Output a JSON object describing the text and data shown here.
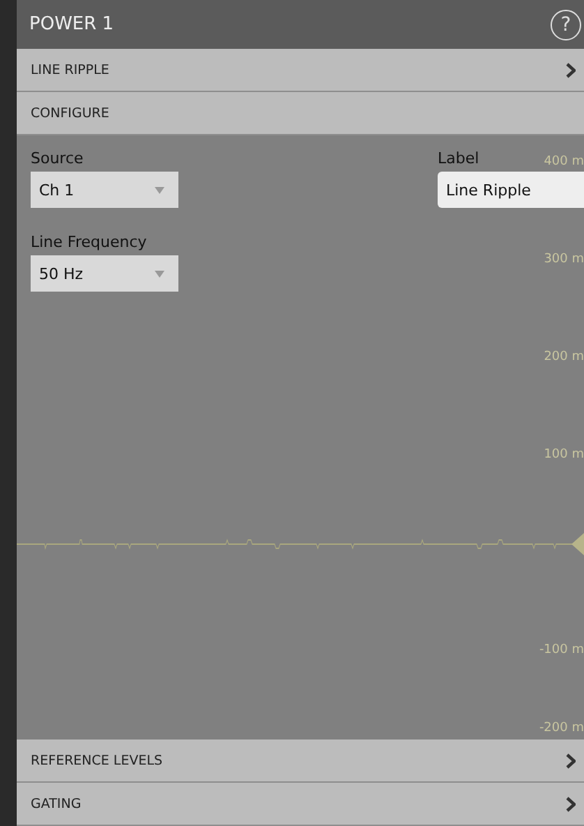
{
  "header": {
    "title": "POWER 1",
    "help_icon": "?"
  },
  "sections_top": [
    {
      "label": "LINE RIPPLE",
      "chevron": true
    },
    {
      "label": "CONFIGURE",
      "chevron": false
    }
  ],
  "configure": {
    "source": {
      "label": "Source",
      "value": "Ch 1"
    },
    "line_frequency": {
      "label": "Line Frequency",
      "value": "50 Hz"
    },
    "label_field": {
      "label": "Label",
      "value": "Line Ripple"
    }
  },
  "axis_labels": [
    "400 m",
    "300 m",
    "200 m",
    "100 m",
    "-100 m",
    "-200 m"
  ],
  "sections_bottom": [
    {
      "label": "REFERENCE LEVELS",
      "chevron": true
    },
    {
      "label": "GATING",
      "chevron": true
    }
  ]
}
